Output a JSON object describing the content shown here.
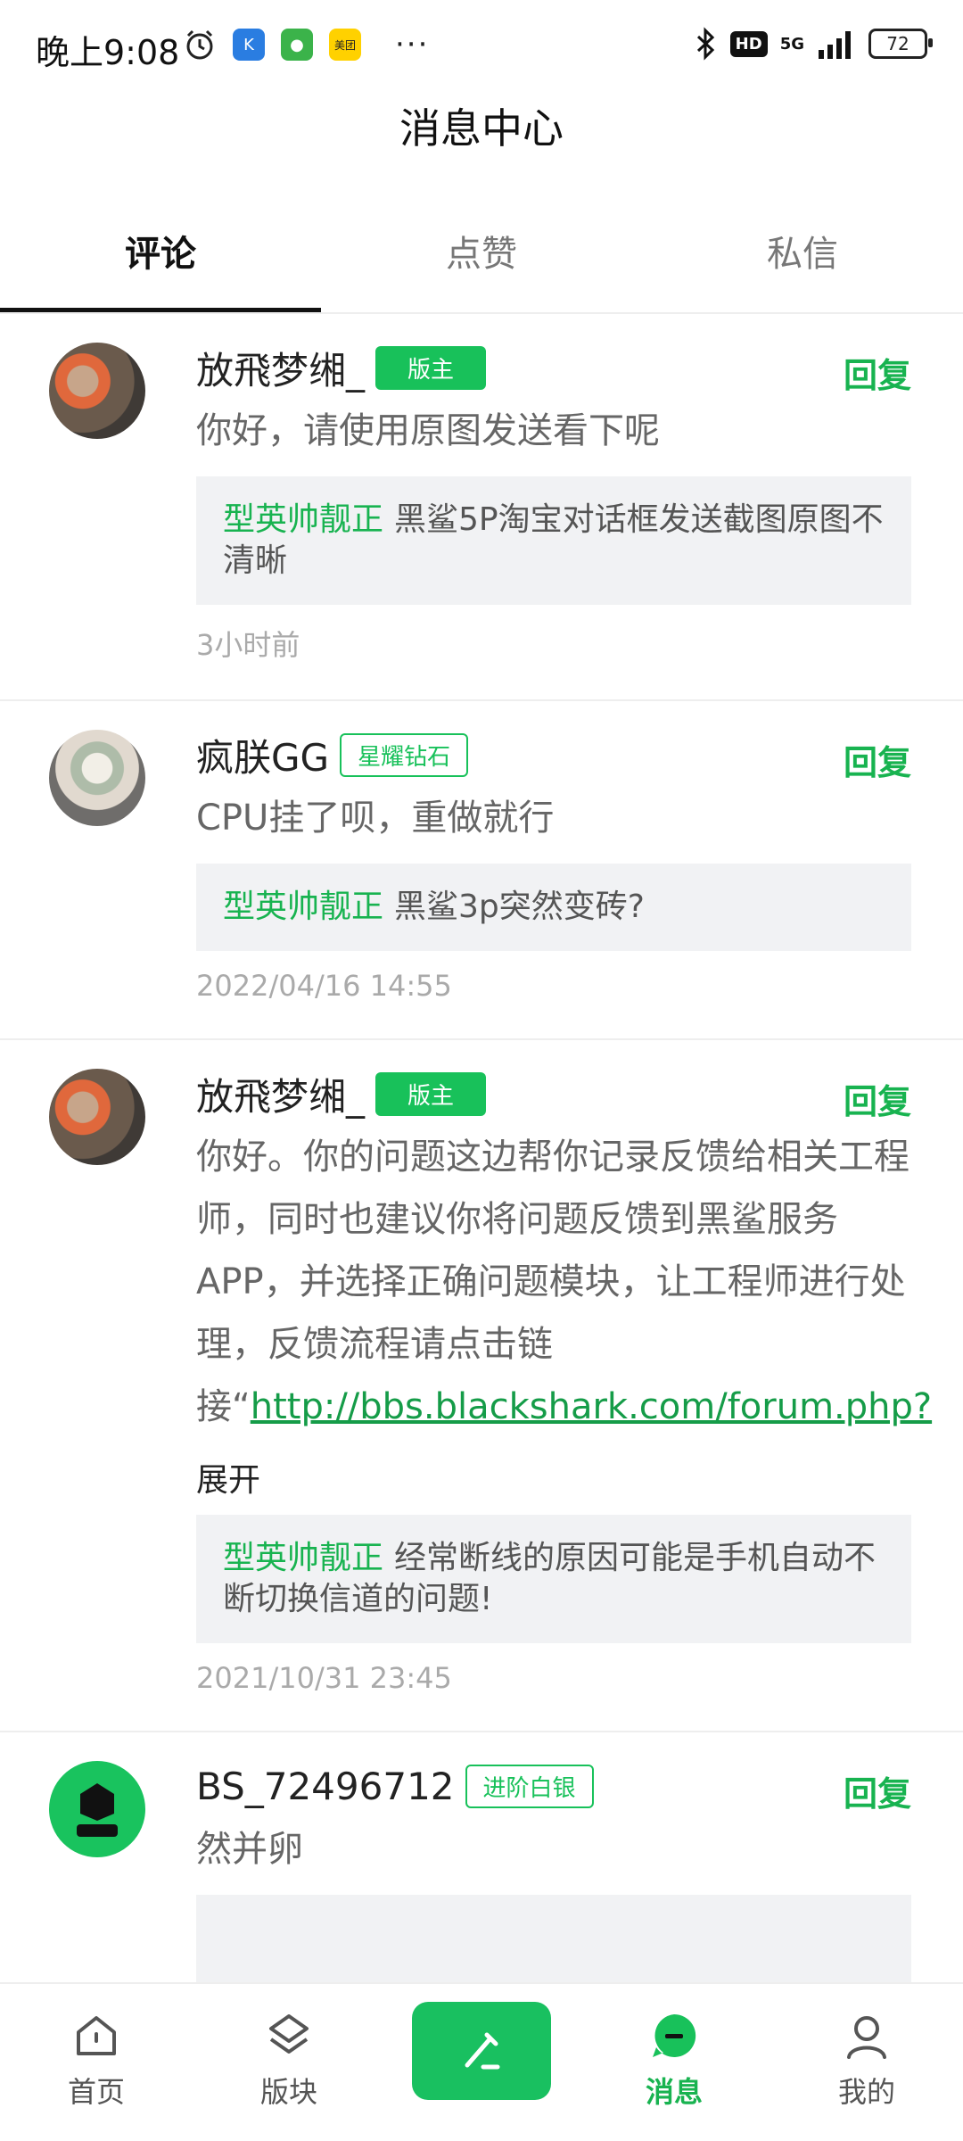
{
  "status_bar": {
    "time": "晚上9:08",
    "hd": "HD",
    "network": "5G",
    "battery": "72",
    "meituan_label": "美团"
  },
  "header": {
    "title": "消息中心"
  },
  "tabs": [
    {
      "label": "评论",
      "active": true
    },
    {
      "label": "点赞",
      "active": false
    },
    {
      "label": "私信",
      "active": false
    }
  ],
  "comments": [
    {
      "name": "放飛梦缃_",
      "badge": "版主",
      "reply": "回复",
      "text": "你好，请使用原图发送看下呢",
      "quote_name": "型英帅靓正",
      "quote_text": "黑鲨5P淘宝对话框发送截图原图不清晰",
      "time": "3小时前"
    },
    {
      "name": "疯朕GG",
      "badge": "星耀钻石",
      "reply": "回复",
      "text": "CPU挂了呗，重做就行",
      "quote_name": "型英帅靓正",
      "quote_text": "黑鲨3p突然变砖?",
      "time": "2022/04/16 14:55"
    },
    {
      "name": "放飛梦缃_",
      "badge": "版主",
      "reply": "回复",
      "text": "你好。你的问题这边帮你记录反馈给相关工程师，同时也建议你将问题反馈到黑鲨服务APP，并选择正确问题模块，让工程师进行处理，反馈流程请点击链接“",
      "link": "http://bbs.blackshark.com/forum.php?",
      "expand": "展开",
      "quote_name": "型英帅靓正",
      "quote_text": "经常断线的原因可能是手机自动不断切换信道的问题!",
      "time": "2021/10/31 23:45"
    },
    {
      "name": "BS_72496712",
      "badge": "进阶白银",
      "reply": "回复",
      "text": "然并卵"
    }
  ],
  "bottom_nav": [
    {
      "label": "首页",
      "icon": "home-icon"
    },
    {
      "label": "版块",
      "icon": "layers-icon"
    },
    {
      "label": "",
      "icon": "compose-icon"
    },
    {
      "label": "消息",
      "icon": "message-icon",
      "active": true
    },
    {
      "label": "我的",
      "icon": "profile-icon"
    }
  ],
  "colors": {
    "accent": "#18C15A",
    "quote_bg": "#F1F2F4"
  }
}
